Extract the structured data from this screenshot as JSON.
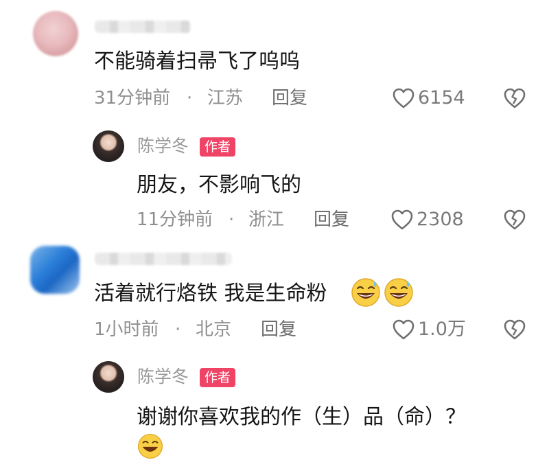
{
  "comments": [
    {
      "text": "不能骑着扫帚飞了呜呜",
      "time": "31分钟前",
      "sep": "·",
      "location": "江苏",
      "reply_label": "回复",
      "likes": "6154"
    },
    {
      "author": "陈学冬",
      "badge": "作者",
      "text": "朋友，不影响飞的",
      "time": "11分钟前",
      "sep": "·",
      "location": "浙江",
      "reply_label": "回复",
      "likes": "2308"
    },
    {
      "text": "活着就行烙铁 我是生命粉",
      "time": "1小时前",
      "sep": "·",
      "location": "北京",
      "reply_label": "回复",
      "likes": "1.0万"
    },
    {
      "author": "陈学冬",
      "badge": "作者",
      "text": "谢谢你喜欢我的作（生）品（命）？"
    }
  ],
  "icons": {
    "like": "heart-outline-icon",
    "dislike": "broken-heart-icon",
    "emoji": "laughing-sweat-emoji"
  },
  "colors": {
    "badge": "#f04467",
    "meta": "#8f8f8f",
    "text": "#151515"
  }
}
